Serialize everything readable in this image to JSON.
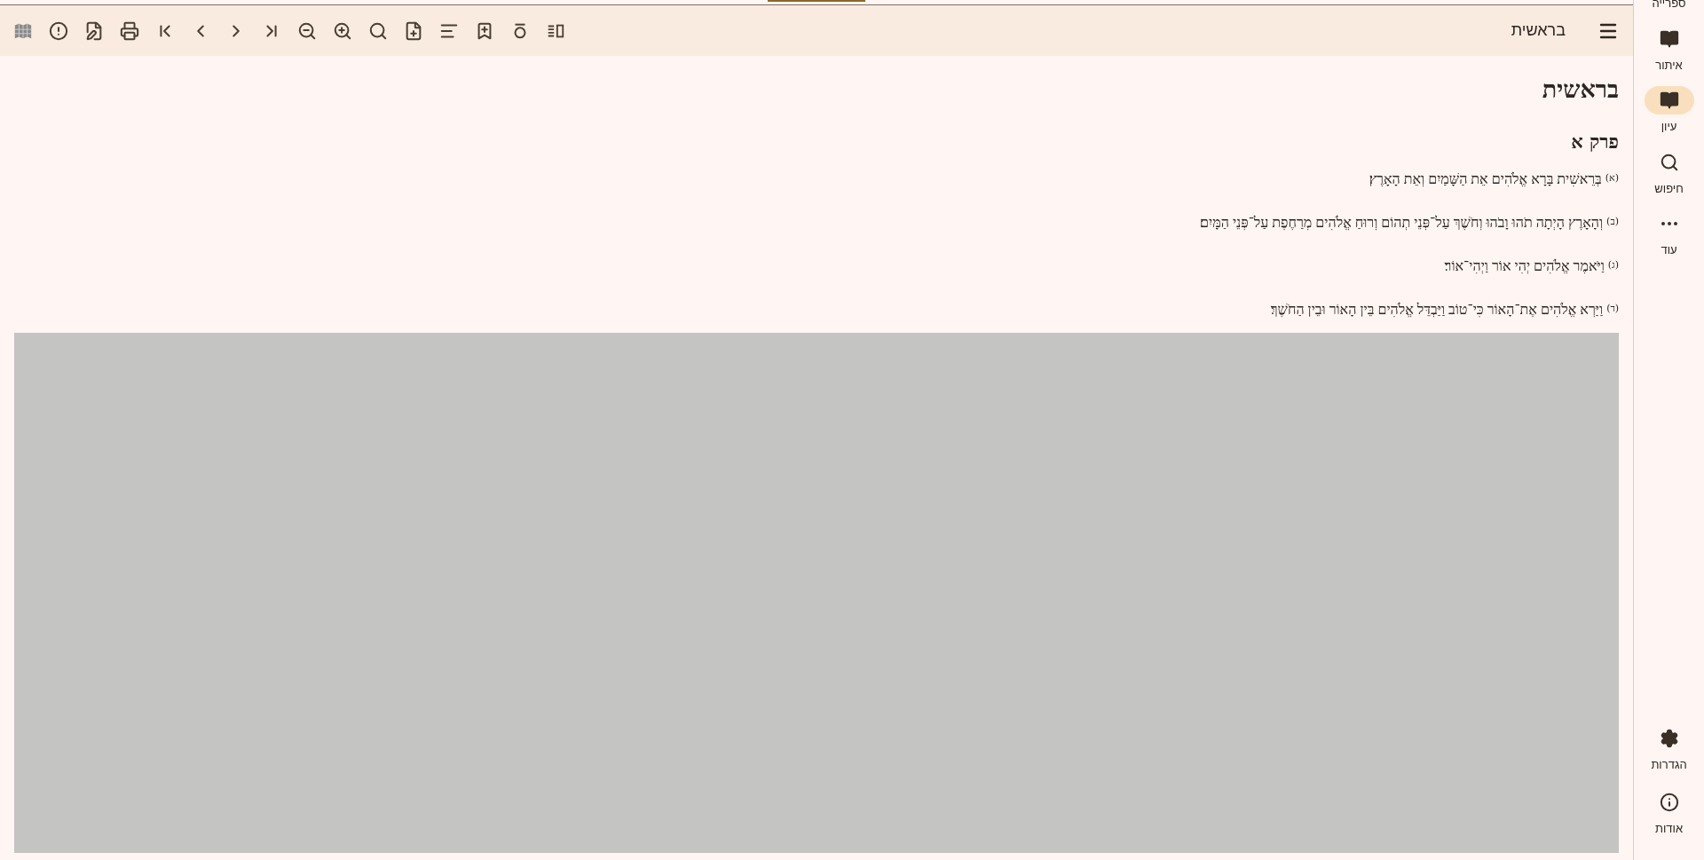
{
  "toolbar": {
    "title": "בראשית"
  },
  "content": {
    "book_title": "בראשית",
    "chapter_title": "פרק א",
    "verses": [
      {
        "marker": "(א)",
        "text": "בְּרֵאשִׁית בָּרָא אֱלֹהִים אֵת הַשָּׁמַיִם וְאֵת הָאָרֶץ׃"
      },
      {
        "marker": "(ב)",
        "text": "וְהָאָרֶץ הָיְתָה תֹהוּ וָבֹהוּ וְחֹשֶׁךְ עַל־פְּנֵי תְהוֹם וְרוּחַ אֱלֹהִים מְרַחֶפֶת עַל־פְּנֵי הַמָּיִם׃"
      },
      {
        "marker": "(ג)",
        "text": "וַיֹּאמֶר אֱלֹהִים יְהִי אוֹר וַיְהִי־אוֹר׃"
      },
      {
        "marker": "(ד)",
        "text": "וַיַּרְא אֱלֹהִים אֶת־הָאוֹר כִּי־טוֹב וַיַּבְדֵּל אֱלֹהִים בֵּין הָאוֹר וּבֵין הַחֹשֶׁךְ׃"
      }
    ]
  },
  "sidebar": {
    "top_items": [
      {
        "label": "ספרייה",
        "kind": "cut",
        "selected": false
      },
      {
        "label": "איתור",
        "kind": "find",
        "selected": false
      },
      {
        "label": "עיון",
        "kind": "read",
        "selected": true
      },
      {
        "label": "חיפוש",
        "kind": "search",
        "selected": false
      },
      {
        "label": "עוד",
        "kind": "more",
        "selected": false
      }
    ],
    "bottom_items": [
      {
        "label": "הגדרות",
        "kind": "settings",
        "selected": false
      },
      {
        "label": "אודות",
        "kind": "about",
        "selected": false
      }
    ]
  }
}
